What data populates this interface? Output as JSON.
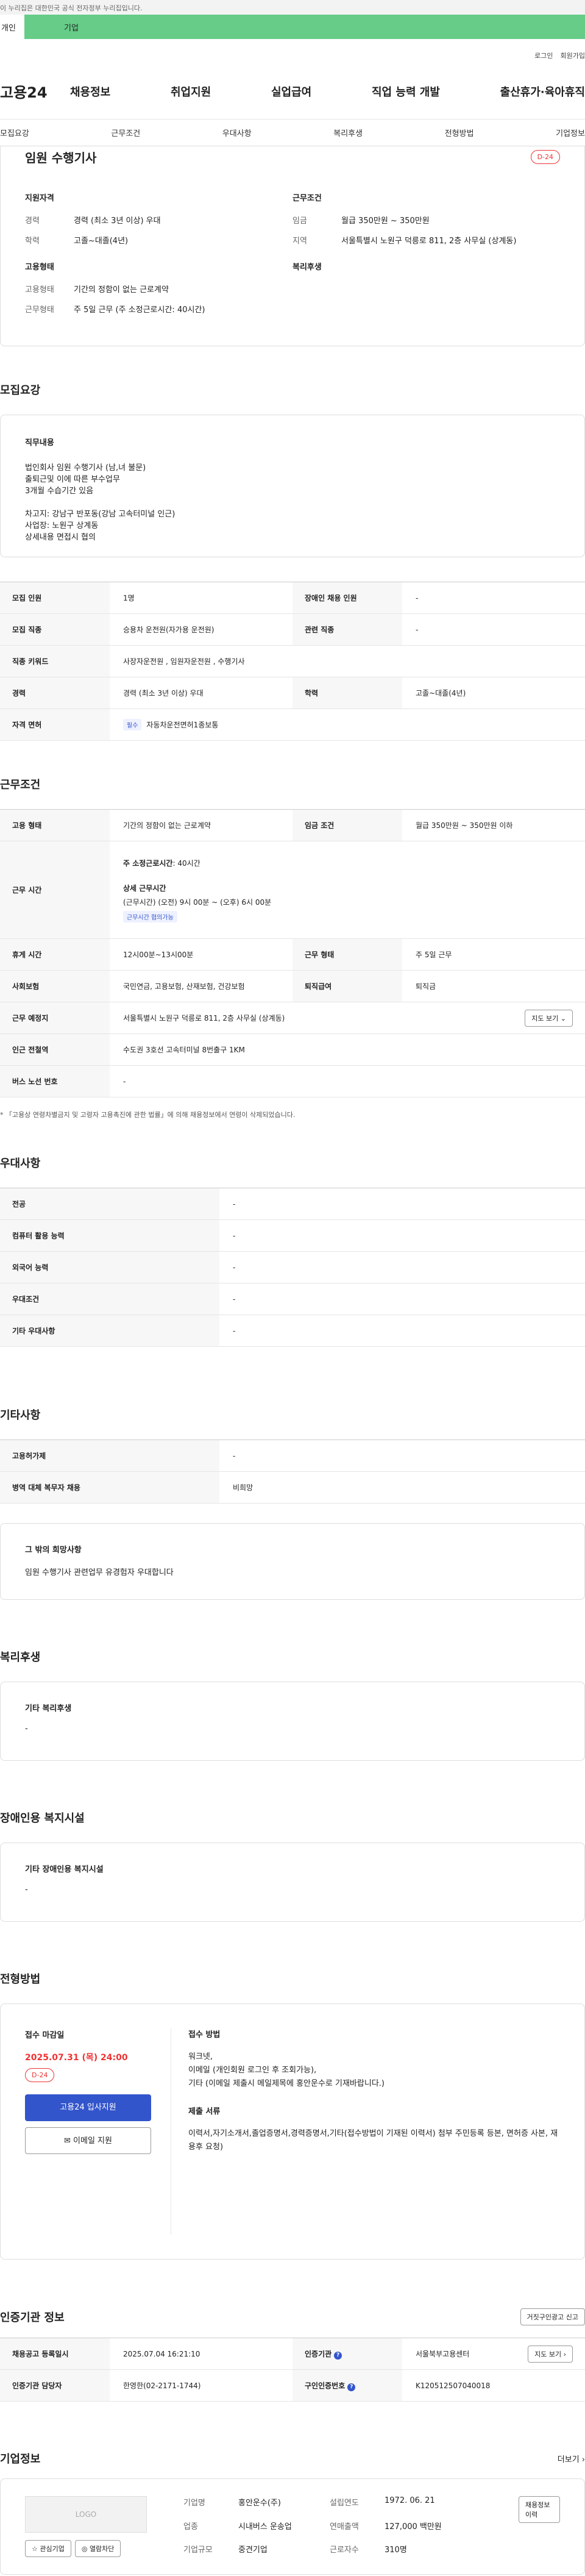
{
  "topbar": {
    "notice": "이 누리집은 대한민국 공식 전자정부 누리집입니다.",
    "left": "개인",
    "green": "기업"
  },
  "util": {
    "login": "로그인",
    "signup": "회원가입"
  },
  "gnb": {
    "logo": "고용24",
    "menu": [
      "채용정보",
      "취업지원",
      "실업급여",
      "직업 능력 개발",
      "출산휴가·육아휴직"
    ]
  },
  "tabs": [
    "모집요강",
    "근무조건",
    "우대사항",
    "복리후생",
    "전형방법",
    "기업정보"
  ],
  "job": {
    "title": "임원 수행기사",
    "dday": "D-24",
    "qual_title": "지원자격",
    "qual": [
      {
        "k": "경력",
        "v": "경력 (최소 3년 이상) 우대"
      },
      {
        "k": "학력",
        "v": "고졸~대졸(4년)"
      }
    ],
    "cond_title": "근무조건",
    "cond": [
      {
        "k": "임금",
        "v": "월급 350만원 ~ 350만원"
      },
      {
        "k": "지역",
        "v": "서울특별시 노원구 덕릉로 811, 2층 사무실 (상계동)"
      }
    ],
    "emp_title": "고용형태",
    "emp": [
      {
        "k": "고용형태",
        "v": "기간의 정함이 없는 근로계약"
      },
      {
        "k": "근무형태",
        "v": "주 5일 근무 (주 소정근로시간: 40시간)"
      }
    ],
    "welfare_title": "복리후생"
  },
  "recruit": {
    "title": "모집요강",
    "desc_title": "직무내용",
    "desc": [
      "법인회사 임원 수행기사 (남,녀 불문)",
      "출퇴근및 이에 따른 부수업무",
      "3개월 수습기간 있음",
      "",
      "차고지: 강남구 반포동(강남 고속터미널 인근)",
      "사업장: 노원구 상계동",
      "상세내용 면접시 협의"
    ],
    "rows": [
      {
        "k1": "모집 인원",
        "v1": "1명",
        "k2": "장애인 채용 인원",
        "v2": "-"
      },
      {
        "k1": "모집 직종",
        "v1": "승용차 운전원(자가용 운전원)",
        "k2": "관련 직종",
        "v2": "-"
      },
      {
        "k1": "직종 키워드",
        "v1": "사장자운전원 , 임원자운전원 , 수행기사"
      },
      {
        "k1": "경력",
        "v1": "경력 (최소 3년 이상) 우대",
        "k2": "학력",
        "v2": "고졸~대졸(4년)"
      },
      {
        "k1": "자격 면허",
        "pill": "필수",
        "v1": "자동차운전면허1종보통"
      }
    ]
  },
  "work": {
    "title": "근무조건",
    "r1": {
      "k1": "고용 형태",
      "v1": "기간의 정함이 없는 근로계약",
      "k2": "임금 조건",
      "v2": "월급 350만원 ~ 350만원 이하"
    },
    "r2": {
      "k": "근무 시간",
      "line1_label": "주 소정근로시간",
      "line1_val": ": 40시간",
      "detail_title": "상세 근무시간",
      "detail": "(근무시간) (오전) 9시 00분 ~ (오후) 6시 00분",
      "pill": "근무시간 협의가능"
    },
    "r3": {
      "k1": "휴게 시간",
      "v1": "12시00분~13시00분",
      "k2": "근무 형태",
      "v2": "주 5일 근무"
    },
    "r4": {
      "k1": "사회보험",
      "v1": "국민연금, 고용보험, 산재보험, 건강보험",
      "k2": "퇴직급여",
      "v2": "퇴직금"
    },
    "r5": {
      "k": "근무 예정지",
      "v": "서울특별시 노원구 덕릉로 811, 2층 사무실 (상계동)",
      "btn": "지도 보기 ⌄"
    },
    "r6": {
      "k": "인근 전철역",
      "v": "수도권 3호선 고속터미널 8번출구 1KM"
    },
    "r7": {
      "k": "버스 노선 번호",
      "v": "-"
    },
    "note": "* 「고용상 연령차별금지 및 고령자 고용촉진에 관한 법률」에 의해 채용정보에서 연령이 삭제되었습니다."
  },
  "pref": {
    "title": "우대사항",
    "rows": [
      {
        "k": "전공",
        "v": "-"
      },
      {
        "k": "컴퓨터 활용 능력",
        "v": "-"
      },
      {
        "k": "외국어 능력",
        "v": "-"
      },
      {
        "k": "우대조건",
        "v": "-"
      },
      {
        "k": "기타 우대사항",
        "v": "-"
      }
    ]
  },
  "etc": {
    "title": "기타사항",
    "rows": [
      {
        "k": "고용허가제",
        "v": "-"
      },
      {
        "k": "병역 대체 복무자 채용",
        "v": "비희망"
      }
    ],
    "hope_title": "그 밖의 희망사항",
    "hope": "임원 수행기사 관련업무 유경험자 우대합니다"
  },
  "welfare": {
    "title": "복리후생",
    "sub": "기타 복리후생",
    "v": "-"
  },
  "disab": {
    "title": "장애인용 복지시설",
    "sub": "기타 장애인용 복지시설",
    "v": "-"
  },
  "screen": {
    "title": "전형방법",
    "deadline_label": "접수 마감일",
    "deadline": "2025.07.31 (목) 24:00",
    "dday": "D-24",
    "btn_apply": "고용24 입사지원",
    "btn_mail": "이메일 지원",
    "method_title": "접수 방법",
    "method": [
      "워크넷,",
      "이메일 (개인회원 로그인 후 조회가능),",
      "기타 (이메일 제출시 메일제목에 홍안운수로 기재바랍니다.)"
    ],
    "docs_title": "제출 서류",
    "docs": "이력서,자기소개서,졸업증명서,경력증명서,기타(접수방법이 기재된 이력서) 첨부 주민등록 등본, 면허증 사본, 재용후 요청)"
  },
  "agency": {
    "title": "인증기관 정보",
    "report_btn": "거짓구인광고 신고",
    "rows": [
      {
        "k1": "채용공고 등록일시",
        "v1": "2025.07.04 16:21:10",
        "k2": "인증기관",
        "v2": "서울북부고용센터",
        "btn": "지도 보기 ›"
      },
      {
        "k1": "인증기관 담당자",
        "v1": "한영한(02-2171-1744)",
        "k2": "구인인증번호",
        "v2": "K120512507040018"
      }
    ]
  },
  "company": {
    "title": "기업정보",
    "more": "더보기 ›",
    "logo": "LOGO",
    "fav": "☆ 관심기업",
    "view": "◎ 열람차단",
    "rows": [
      {
        "k": "기업명",
        "v": "홍안운수(주)",
        "k2": "설립연도",
        "v2": "1972. 06. 21"
      },
      {
        "k": "업종",
        "v": "시내버스 운송업",
        "k2": "연매출액",
        "v2": "127,000 백만원"
      },
      {
        "k": "기업규모",
        "v": "중견기업",
        "k2": "근로자수",
        "v2": "310명"
      }
    ],
    "btn": "채용정보 이력"
  }
}
